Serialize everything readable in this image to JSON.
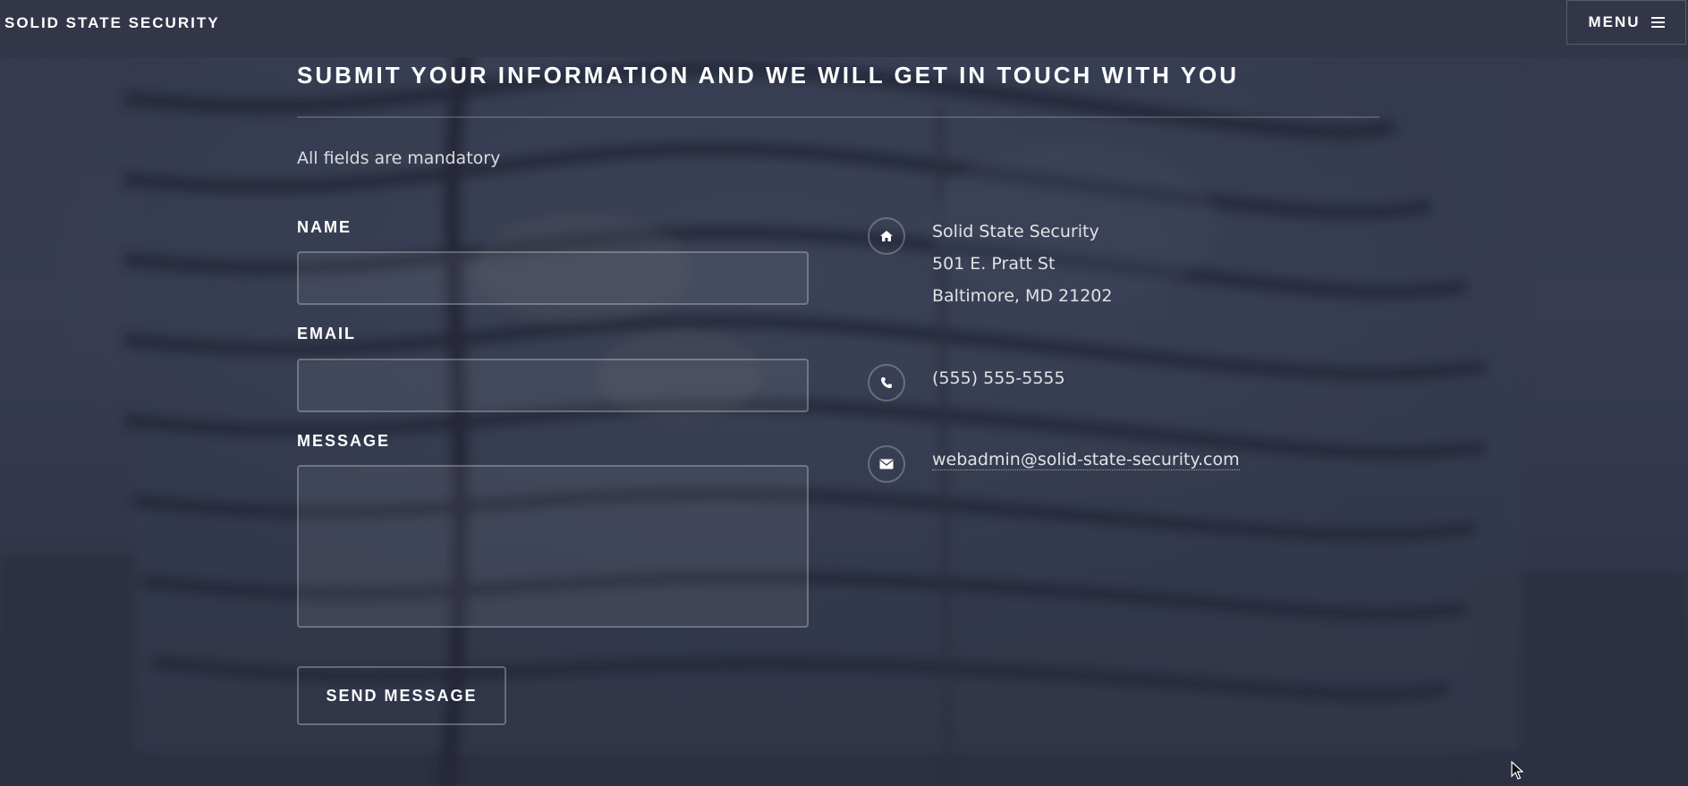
{
  "header": {
    "brand": "SOLID STATE SECURITY",
    "menu_label": "MENU"
  },
  "contact_section": {
    "title": "SUBMIT YOUR INFORMATION AND WE WILL GET IN TOUCH WITH YOU",
    "note": "All fields are mandatory",
    "form": {
      "name_label": "NAME",
      "name_value": "",
      "email_label": "EMAIL",
      "email_value": "",
      "message_label": "MESSAGE",
      "message_value": "",
      "submit_label": "SEND MESSAGE"
    },
    "info": {
      "address": {
        "icon": "home-icon",
        "lines": [
          "Solid State Security",
          "501 E. Pratt St",
          "Baltimore, MD 21202"
        ]
      },
      "phone": {
        "icon": "phone-icon",
        "text": "(555) 555-5555"
      },
      "email": {
        "icon": "envelope-icon",
        "text": "webadmin@solid-state-security.com"
      }
    }
  },
  "colors": {
    "header_bg": "#323648",
    "page_bg": "#2f3446",
    "text": "#ffffff"
  }
}
